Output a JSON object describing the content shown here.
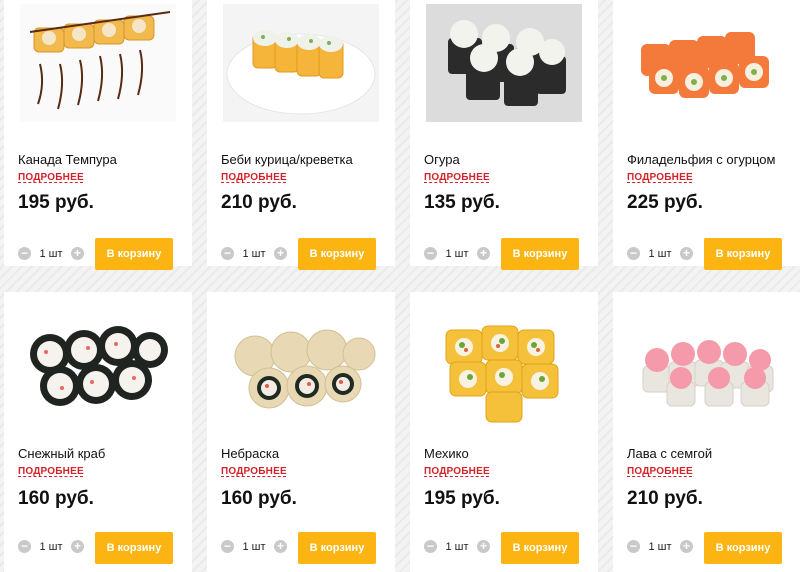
{
  "products": [
    {
      "name": "Канада Темпура",
      "more": "ПОДРОБНЕЕ",
      "price": "195 руб.",
      "qty": "1 шт",
      "cart": "В корзину",
      "image": "canada-tempura-roll-image"
    },
    {
      "name": "Беби курица/креветка",
      "more": "ПОДРОБНЕЕ",
      "price": "210 руб.",
      "qty": "1 шт",
      "cart": "В корзину",
      "image": "baby-chicken-shrimp-roll-image"
    },
    {
      "name": "Огура",
      "more": "ПОДРОБНЕЕ",
      "price": "135 руб.",
      "qty": "1 шт",
      "cart": "В корзину",
      "image": "ogura-roll-image"
    },
    {
      "name": "Филадельфия с огурцом",
      "more": "ПОДРОБНЕЕ",
      "price": "225 руб.",
      "qty": "1 шт",
      "cart": "В корзину",
      "image": "philadelphia-cucumber-roll-image"
    },
    {
      "name": "Снежный краб",
      "more": "ПОДРОБНЕЕ",
      "price": "160 руб.",
      "qty": "1 шт",
      "cart": "В корзину",
      "image": "snow-crab-roll-image"
    },
    {
      "name": "Небраска",
      "more": "ПОДРОБНЕЕ",
      "price": "160 руб.",
      "qty": "1 шт",
      "cart": "В корзину",
      "image": "nebraska-roll-image"
    },
    {
      "name": "Мехико",
      "more": "ПОДРОБНЕЕ",
      "price": "195 руб.",
      "qty": "1 шт",
      "cart": "В корзину",
      "image": "mexico-roll-image"
    },
    {
      "name": "Лава с семгой",
      "more": "ПОДРОБНЕЕ",
      "price": "210 руб.",
      "qty": "1 шт",
      "cart": "В корзину",
      "image": "lava-salmon-roll-image"
    }
  ],
  "icons": {
    "minus": "minus-icon",
    "plus": "plus-icon"
  },
  "colors": {
    "cart_button": "#fbb411",
    "more_link": "#d3232a",
    "qty_button": "#c9c9c9"
  }
}
